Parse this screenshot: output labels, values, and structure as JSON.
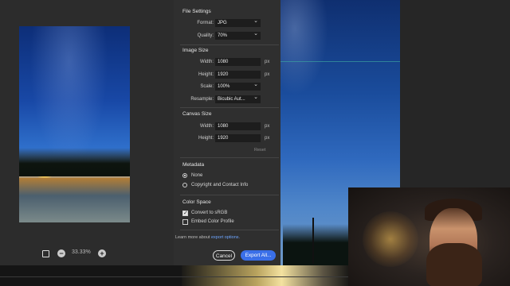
{
  "zoom": {
    "value": "33.33%",
    "fit_icon": "fit-to-screen-icon",
    "zoom_out_icon": "minus-circle-icon",
    "zoom_in_icon": "plus-circle-icon"
  },
  "file_settings": {
    "title": "File Settings",
    "format_label": "Format:",
    "format_value": "JPG",
    "quality_label": "Quality:",
    "quality_value": "70%"
  },
  "image_size": {
    "title": "Image Size",
    "width_label": "Width:",
    "width_value": "1080",
    "width_unit": "px",
    "height_label": "Height:",
    "height_value": "1920",
    "height_unit": "px",
    "scale_label": "Scale:",
    "scale_value": "100%",
    "resample_label": "Resample:",
    "resample_value": "Bicubic Aut..."
  },
  "canvas_size": {
    "title": "Canvas Size",
    "width_label": "Width:",
    "width_value": "1080",
    "width_unit": "px",
    "height_label": "Height:",
    "height_value": "1920",
    "height_unit": "px",
    "reset_label": "Reset"
  },
  "metadata": {
    "title": "Metadata",
    "options": [
      {
        "label": "None",
        "selected": true
      },
      {
        "label": "Copyright and Contact Info",
        "selected": false
      }
    ]
  },
  "color_space": {
    "title": "Color Space",
    "options": [
      {
        "label": "Convert to sRGB",
        "checked": true
      },
      {
        "label": "Embed Color Profile",
        "checked": false
      }
    ]
  },
  "learn_more": {
    "prefix": "Learn more about",
    "link": "export options."
  },
  "buttons": {
    "cancel": "Cancel",
    "export": "Export All..."
  },
  "colors": {
    "accent": "#3a6fe8",
    "link": "#6ea6ff",
    "panel": "#2f2f2f"
  }
}
